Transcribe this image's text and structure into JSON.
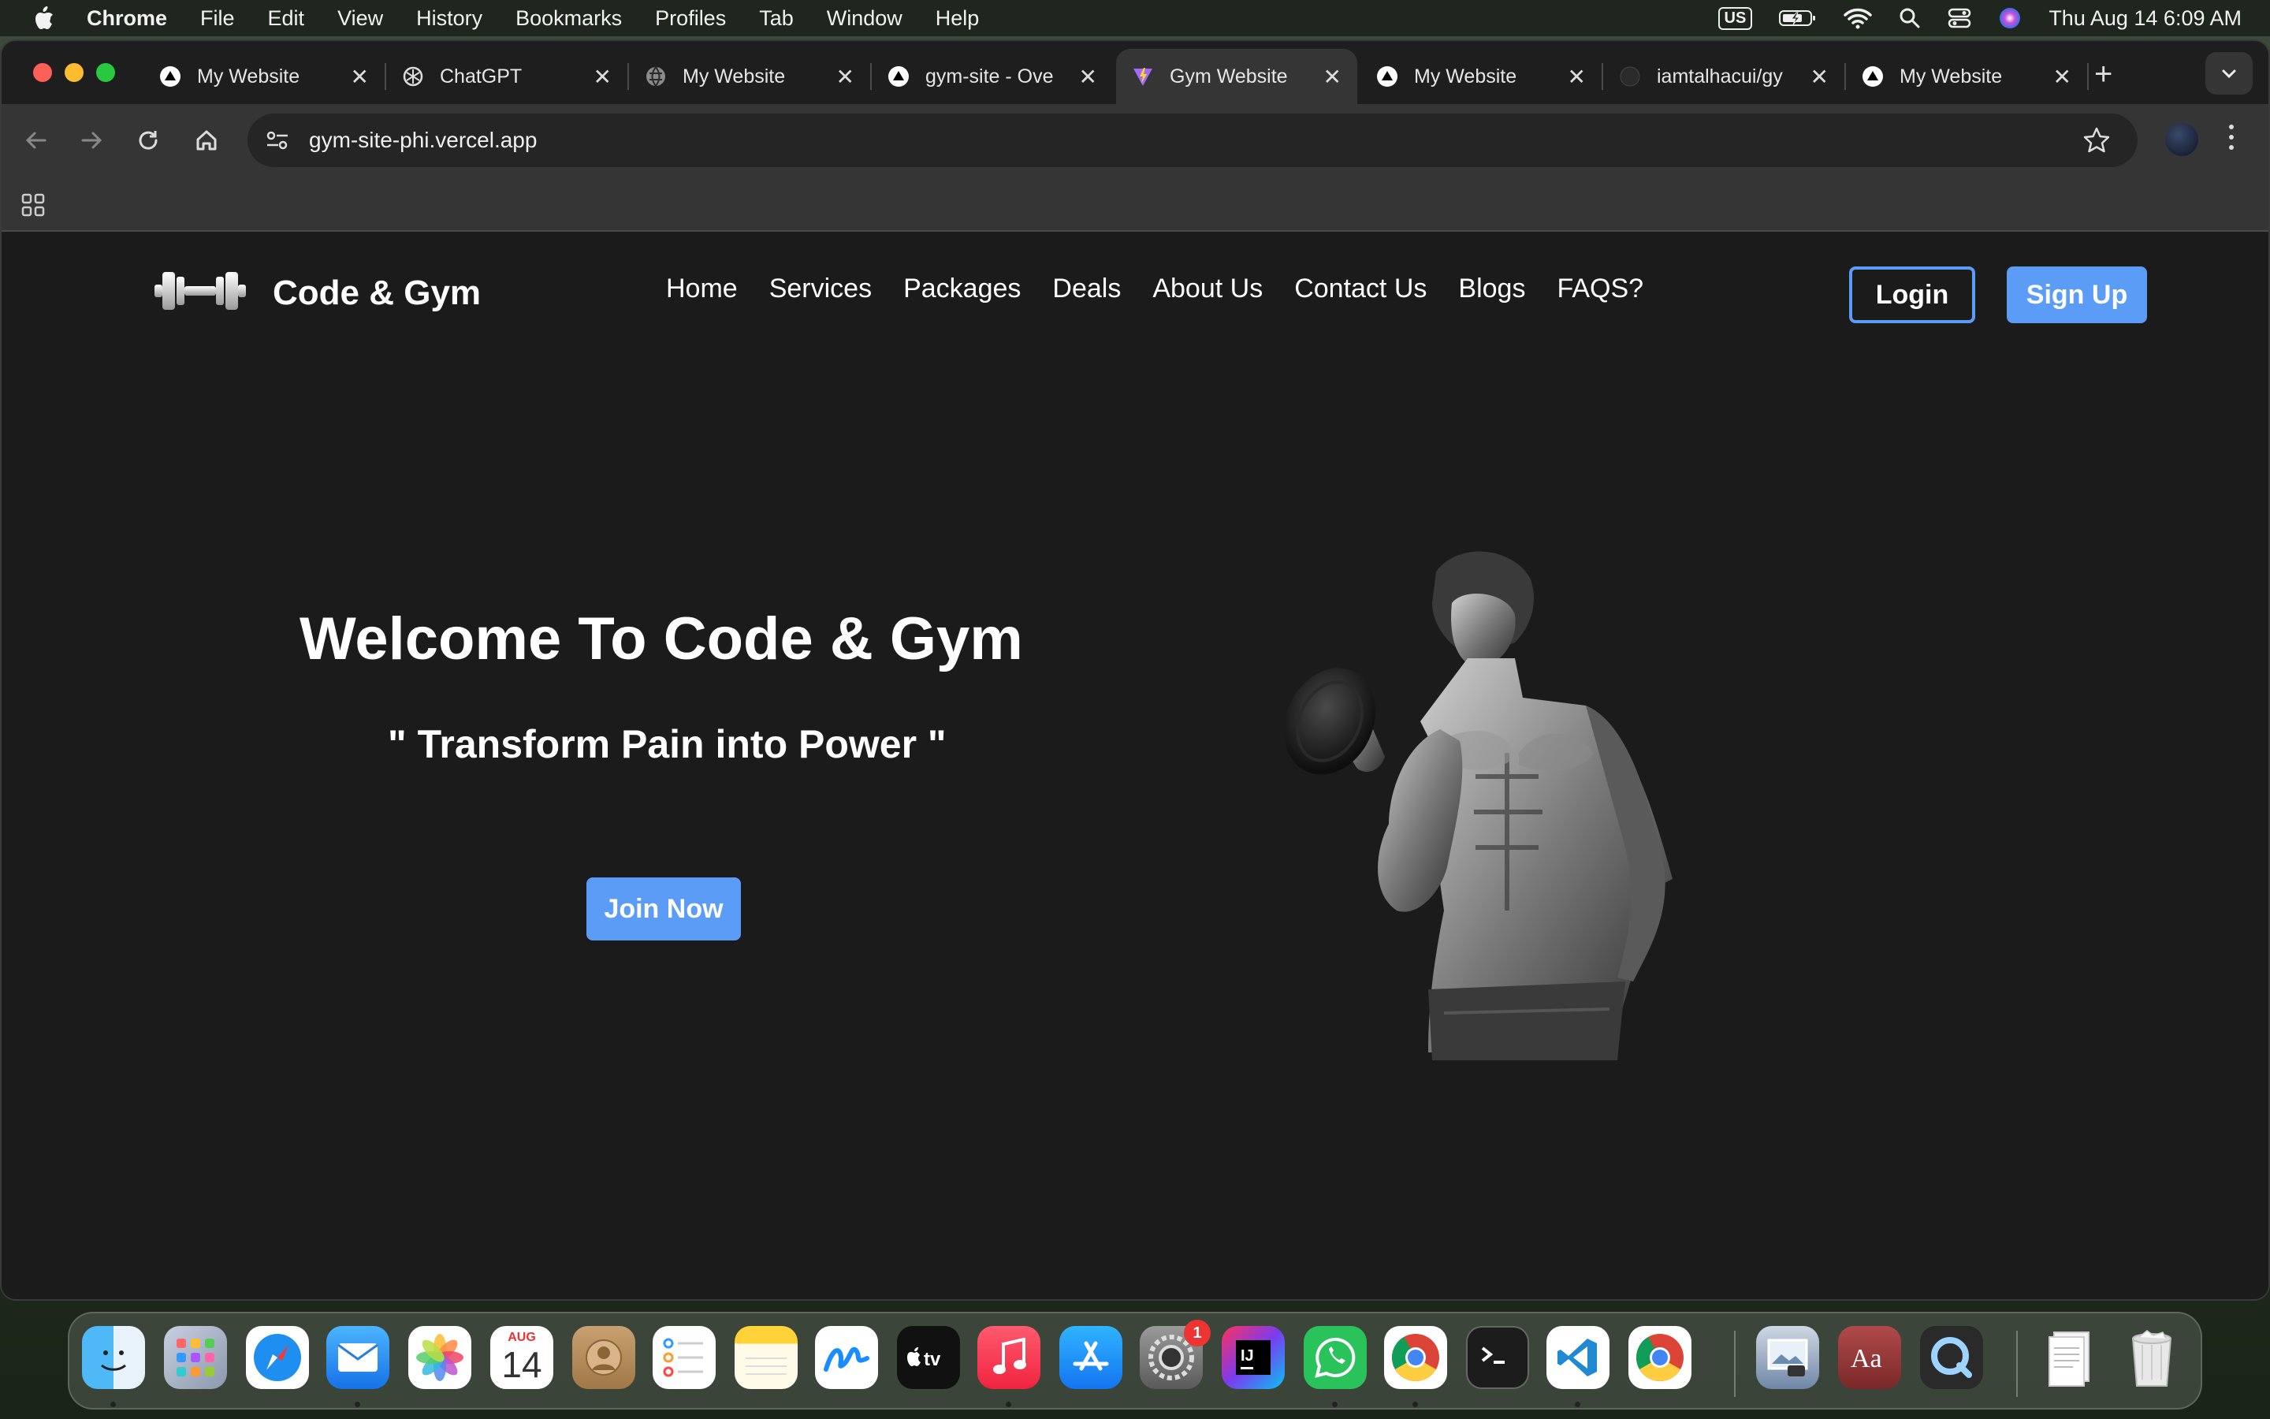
{
  "menubar": {
    "app_name": "Chrome",
    "items": [
      "File",
      "Edit",
      "View",
      "History",
      "Bookmarks",
      "Profiles",
      "Tab",
      "Window",
      "Help"
    ],
    "input_source": "US",
    "clock": "Thu Aug 14  6:09 AM"
  },
  "tabs": [
    {
      "title": "My Website",
      "icon": "vercel-icon"
    },
    {
      "title": "ChatGPT",
      "icon": "chatgpt-icon"
    },
    {
      "title": "My Website",
      "icon": "globe-icon"
    },
    {
      "title": "gym-site - Ove",
      "icon": "vercel-icon"
    },
    {
      "title": "Gym Website",
      "icon": "vite-icon",
      "active": true
    },
    {
      "title": "My Website",
      "icon": "vercel-icon"
    },
    {
      "title": "iamtalhacui/gy",
      "icon": "github-icon"
    },
    {
      "title": "My Website",
      "icon": "vercel-icon"
    }
  ],
  "address": {
    "url": "gym-site-phi.vercel.app"
  },
  "site": {
    "brand": "Code & Gym",
    "nav": [
      "Home",
      "Services",
      "Packages",
      "Deals",
      "About Us",
      "Contact Us",
      "Blogs",
      "FAQS?"
    ],
    "login": "Login",
    "signup": "Sign Up",
    "hero_title": "Welcome To Code & Gym",
    "hero_subtitle": "\" Transform Pain into Power \"",
    "join": "Join Now"
  },
  "dock": {
    "calendar_month": "AUG",
    "calendar_day": "14",
    "settings_badge": "1",
    "apps": [
      "finder-icon",
      "launchpad-icon",
      "safari-icon",
      "mail-icon",
      "photos-icon",
      "calendar-icon",
      "contacts-icon",
      "reminders-icon",
      "notes-icon",
      "freeform-icon",
      "appletv-icon",
      "music-icon",
      "appstore-icon",
      "settings-icon",
      "intellij-icon",
      "whatsapp-icon",
      "chrome-icon",
      "terminal-icon",
      "vscode-icon",
      "chrome-icon",
      "preview-icon",
      "dictionary-icon",
      "quicktime-icon",
      "documents-icon",
      "trash-icon"
    ]
  },
  "colors": {
    "accent": "#5b9cf6",
    "page_bg": "#1b1b1b",
    "menubar_bg": "#1f261d"
  }
}
